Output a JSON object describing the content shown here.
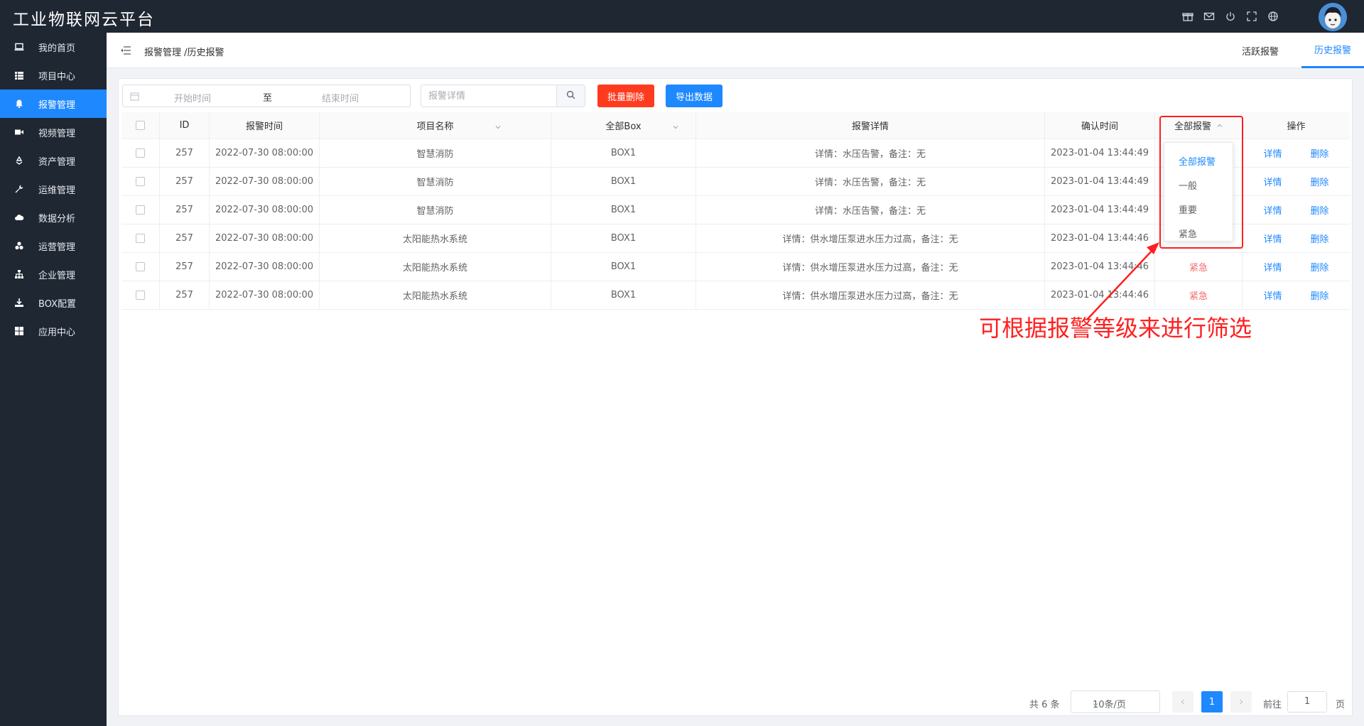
{
  "app": {
    "title": "工业物联网云平台"
  },
  "sidebar": {
    "items": [
      {
        "label": "我的首页",
        "icon": "laptop-icon",
        "active": false
      },
      {
        "label": "项目中心",
        "icon": "list-icon",
        "active": false
      },
      {
        "label": "报警管理",
        "icon": "bell-icon",
        "active": true
      },
      {
        "label": "视频管理",
        "icon": "video-icon",
        "active": false
      },
      {
        "label": "资产管理",
        "icon": "recycle-icon",
        "active": false
      },
      {
        "label": "运维管理",
        "icon": "wrench-icon",
        "active": false
      },
      {
        "label": "数据分析",
        "icon": "cloud-icon",
        "active": false
      },
      {
        "label": "运营管理",
        "icon": "cubes-icon",
        "active": false
      },
      {
        "label": "企业管理",
        "icon": "org-chart-icon",
        "active": false
      },
      {
        "label": "BOX配置",
        "icon": "download-icon",
        "active": false
      },
      {
        "label": "应用中心",
        "icon": "grid-icon",
        "active": false
      }
    ]
  },
  "header": {
    "breadcrumb": "报警管理 /历史报警",
    "tabs": [
      {
        "label": "活跃报警",
        "active": false
      },
      {
        "label": "历史报警",
        "active": true
      }
    ]
  },
  "toolbar": {
    "start_placeholder": "开始时间",
    "range_separator": "至",
    "end_placeholder": "结束时间",
    "search_placeholder": "报警详情",
    "batch_delete_label": "批量删除",
    "export_label": "导出数据"
  },
  "table": {
    "headers": {
      "id": "ID",
      "alarm_time": "报警时间",
      "project": "项目名称",
      "box": "全部Box",
      "detail": "报警详情",
      "confirm_time": "确认时间",
      "level": "全部报警",
      "ops": "操作"
    },
    "rows": [
      {
        "id": "257",
        "alarm_time": "2022-07-30 08:00:00",
        "project": "智慧消防",
        "box": "BOX1",
        "detail": "详情：水压告警，备注：无",
        "confirm_time": "2023-01-04 13:44:49",
        "level": "",
        "op_detail": "详情",
        "op_delete": "删除"
      },
      {
        "id": "257",
        "alarm_time": "2022-07-30 08:00:00",
        "project": "智慧消防",
        "box": "BOX1",
        "detail": "详情：水压告警，备注：无",
        "confirm_time": "2023-01-04 13:44:49",
        "level": "",
        "op_detail": "详情",
        "op_delete": "删除"
      },
      {
        "id": "257",
        "alarm_time": "2022-07-30 08:00:00",
        "project": "智慧消防",
        "box": "BOX1",
        "detail": "详情：水压告警，备注：无",
        "confirm_time": "2023-01-04 13:44:49",
        "level": "",
        "op_detail": "详情",
        "op_delete": "删除"
      },
      {
        "id": "257",
        "alarm_time": "2022-07-30 08:00:00",
        "project": "太阳能热水系统",
        "box": "BOX1",
        "detail": "详情：供水增压泵进水压力过高，备注：无",
        "confirm_time": "2023-01-04 13:44:46",
        "level": "",
        "op_detail": "详情",
        "op_delete": "删除"
      },
      {
        "id": "257",
        "alarm_time": "2022-07-30 08:00:00",
        "project": "太阳能热水系统",
        "box": "BOX1",
        "detail": "详情：供水增压泵进水压力过高，备注：无",
        "confirm_time": "2023-01-04 13:44:46",
        "level": "紧急",
        "op_detail": "详情",
        "op_delete": "删除"
      },
      {
        "id": "257",
        "alarm_time": "2022-07-30 08:00:00",
        "project": "太阳能热水系统",
        "box": "BOX1",
        "detail": "详情：供水增压泵进水压力过高，备注：无",
        "confirm_time": "2023-01-04 13:44:46",
        "level": "紧急",
        "op_detail": "详情",
        "op_delete": "删除"
      }
    ]
  },
  "level_filter": {
    "options": [
      {
        "label": "全部报警",
        "selected": true
      },
      {
        "label": "一般",
        "selected": false
      },
      {
        "label": "重要",
        "selected": false
      },
      {
        "label": "紧急",
        "selected": false
      }
    ]
  },
  "annotation": {
    "text": "可根据报警等级来进行筛选"
  },
  "pagination": {
    "total": "共 6 条",
    "page_size": "10条/页",
    "current_page": "1",
    "goto_label": "前往",
    "goto_value": "1",
    "goto_unit": "页"
  },
  "colors": {
    "sidebar_bg": "#1f2733",
    "accent": "#1e88ff",
    "danger": "#ff3b1f",
    "urgent_text": "#f56c6c",
    "annotation": "#ff1f1f"
  }
}
